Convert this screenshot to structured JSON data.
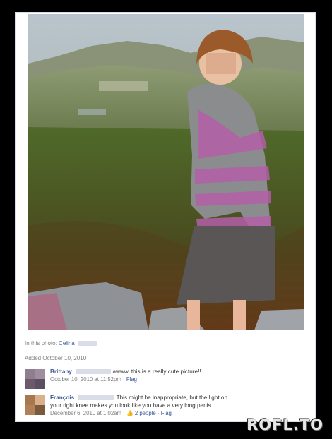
{
  "photo_meta": {
    "in_this_photo_label": "In this photo:",
    "tagged_name": "Celina",
    "added_date": "Added October 10, 2010"
  },
  "comments": [
    {
      "author": "Brittany",
      "text": "awww, this is a really cute picture!!",
      "timestamp": "October 10, 2010 at 11:52pm",
      "separator": "·",
      "flag_label": "Flag"
    },
    {
      "author": "François",
      "text_line1": "This might be inappropriate, but the light on",
      "text_line2": "your right knee makes you look like you have a very long penis.",
      "timestamp": "December 6, 2010 at 1:02am",
      "separator": "·",
      "likes": "2 people",
      "flag_label": "Flag"
    }
  ],
  "watermark": "ROFL.TO",
  "colors": {
    "link_blue": "#3b5998",
    "meta_gray": "#808080",
    "page_black": "#000000"
  }
}
